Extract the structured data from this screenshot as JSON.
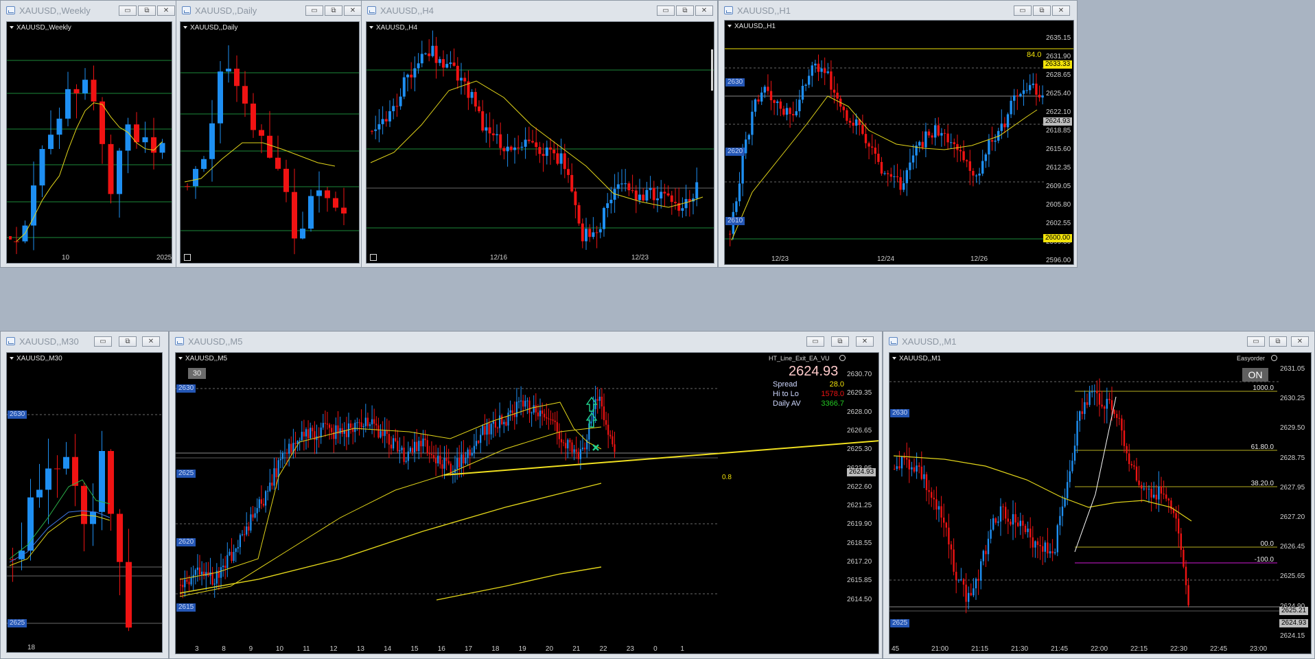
{
  "colors": {
    "bull": "#1e8ff2",
    "bear": "#f01313",
    "ma": "#e3d61a",
    "grid_green": "#1d8a3a",
    "level_gray": "#6a6a6a",
    "level_magenta": "#d21ad6",
    "trend_yellow": "#f0e020",
    "tag_blue": "#2456b4",
    "tag_yellow": "#f2e30a"
  },
  "window_buttons": {
    "minimize": "▭",
    "restore": "⧉",
    "close": "✕"
  },
  "windows": [
    {
      "id": "weekly",
      "title": "XAUUSD,,Weekly",
      "label": "XAUUSD,,Weekly",
      "time_labels": [
        "10",
        "2025"
      ]
    },
    {
      "id": "daily",
      "title": "XAUUSD,,Daily",
      "label": "XAUUSD,,Daily"
    },
    {
      "id": "h4",
      "title": "XAUUSD,,H4",
      "label": "XAUUSD,,H4",
      "time_labels": [
        "12/16",
        "12/23"
      ]
    },
    {
      "id": "h1",
      "title": "XAUUSD,,H1",
      "label": "XAUUSD,,H1",
      "price_labels": [
        "2635.15",
        "2631.90",
        "2628.65",
        "2625.40",
        "2622.10",
        "2618.85",
        "2615.60",
        "2612.35",
        "2609.05",
        "2605.80",
        "2602.55",
        "2599.30",
        "2596.00"
      ],
      "time_labels": [
        "12/23",
        "12/24",
        "12/26"
      ],
      "tags": {
        "level_left_2630": "2630",
        "level_left_2620": "2620",
        "level_left_2610": "2610",
        "level_left_2600": "2600",
        "right_2633": "2633.33",
        "right_2624": "2624.93",
        "right_2600": "2600.00"
      },
      "fib_label": "84.0"
    },
    {
      "id": "m30",
      "title": "XAUUSD,,M30",
      "label": "XAUUSD,,M30",
      "tags": {
        "l2630": "2630",
        "l2625": "2625"
      },
      "time_labels": [
        "18"
      ]
    },
    {
      "id": "m5",
      "title": "XAUUSD,,M5",
      "label": "XAUUSD,,M5",
      "period_badge": "30",
      "ea_name": "HT_Line_Exit_EA_VU",
      "bid": "2624.93",
      "stats": [
        {
          "label": "Spread",
          "value": "28.0",
          "color": "#f2e30a"
        },
        {
          "label": "Hi to Lo",
          "value": "1578.0",
          "color": "#f01313"
        },
        {
          "label": "Daily AV",
          "value": "3366.7",
          "color": "#22c922"
        }
      ],
      "price_labels": [
        "2630.70",
        "2629.35",
        "2628.00",
        "2626.65",
        "2625.30",
        "2623.95",
        "2622.60",
        "2621.25",
        "2619.90",
        "2618.55",
        "2617.20",
        "2615.85",
        "2614.50"
      ],
      "time_labels": [
        "3",
        "8",
        "9",
        "10",
        "11",
        "12",
        "13",
        "14",
        "15",
        "16",
        "17",
        "18",
        "19",
        "20",
        "21",
        "22",
        "23",
        "0",
        "1"
      ],
      "tags": {
        "l2630": "2630",
        "l2625": "2625",
        "l2620": "2620",
        "l2615": "2615",
        "right_price": "2624.93"
      },
      "trend_label": "0.8"
    },
    {
      "id": "m1",
      "title": "XAUUSD,,M1",
      "label": "XAUUSD,,M1",
      "easyorder_label": "Easyorder",
      "easyorder_state": "ON",
      "price_labels": [
        "2631.05",
        "2630.25",
        "2629.50",
        "2628.75",
        "2627.95",
        "2627.20",
        "2626.45",
        "2625.65",
        "2624.90",
        "2624.15"
      ],
      "time_labels": [
        "45",
        "21:00",
        "21:15",
        "21:30",
        "21:45",
        "22:00",
        "22:15",
        "22:30",
        "22:45",
        "23:00"
      ],
      "fib_levels": [
        "1000.0",
        "61.80.0",
        "38.20.0",
        "00.0",
        "-100.0"
      ],
      "tags": {
        "l2630": "2630",
        "l2625": "2625",
        "right_2625": "2625.21",
        "right_2624": "2624.93"
      }
    }
  ]
}
